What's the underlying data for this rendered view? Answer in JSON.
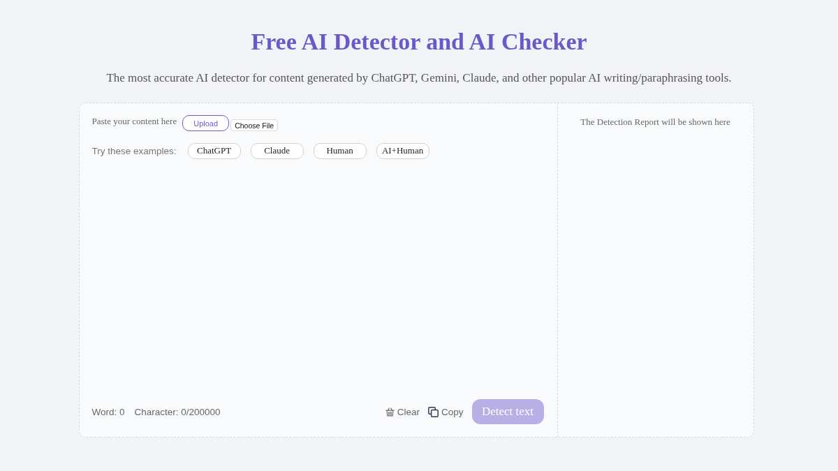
{
  "header": {
    "title": "Free AI Detector and AI Checker",
    "subtitle": "The most accurate AI detector for content generated by ChatGPT, Gemini, Claude, and other popular AI writing/paraphrasing tools."
  },
  "editor": {
    "paste_label": "Paste your content here",
    "upload_button": "Upload",
    "file_button": "Choose File",
    "examples_label": "Try these examples:",
    "examples": [
      "ChatGPT",
      "Claude",
      "Human",
      "AI+Human"
    ],
    "word_count": "Word: 0",
    "character_count": "Character: 0/200000",
    "actions": [
      {
        "kind": "clear",
        "label": "Clear"
      },
      {
        "kind": "copy",
        "label": "Copy"
      }
    ],
    "detect_button": {
      "label": "Detect text",
      "disabled": true
    }
  },
  "report": {
    "message": "The Detection Report will be shown here"
  }
}
